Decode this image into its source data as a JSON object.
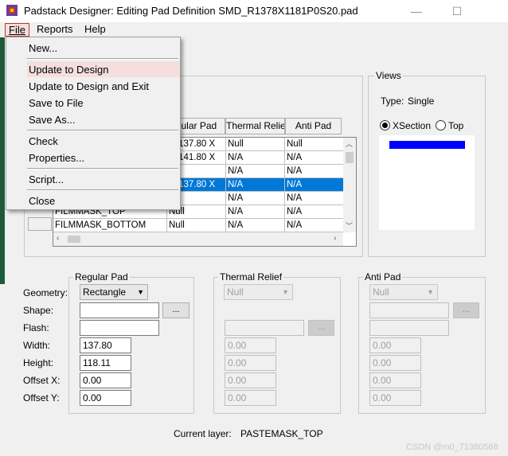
{
  "window": {
    "title": "Padstack Designer: Editing Pad Definition SMD_R1378X1181P0S20.pad",
    "minimize": "—",
    "maximize": "☐"
  },
  "menubar": {
    "items": [
      {
        "label": "File"
      },
      {
        "label": "Reports"
      },
      {
        "label": "Help"
      }
    ]
  },
  "file_menu": {
    "items": [
      {
        "label": "New..."
      },
      {
        "label": "Update to Design"
      },
      {
        "label": "Update to Design and Exit"
      },
      {
        "label": "Save to File"
      },
      {
        "label": "Save As..."
      },
      {
        "label": "Check"
      },
      {
        "label": "Properties..."
      },
      {
        "label": "Script..."
      },
      {
        "label": "Close"
      }
    ],
    "highlighted": "Update to Design"
  },
  "layer_grid": {
    "headers": [
      "gular Pad",
      "Thermal Relief",
      "Anti Pad"
    ],
    "rows": [
      {
        "layer": "",
        "regular": "ct 137.80 X",
        "thermal": "Null",
        "anti": "Null"
      },
      {
        "layer": "",
        "regular": "ct 141.80 X",
        "thermal": "N/A",
        "anti": "N/A"
      },
      {
        "layer": "",
        "regular": "l",
        "thermal": "N/A",
        "anti": "N/A"
      },
      {
        "layer": "",
        "regular": "ct 137.80 X",
        "thermal": "N/A",
        "anti": "N/A",
        "selected": true
      },
      {
        "layer": "",
        "regular": "",
        "thermal": "N/A",
        "anti": "N/A"
      },
      {
        "layer": "FILMMASK_TOP",
        "regular": "Null",
        "thermal": "N/A",
        "anti": "N/A"
      },
      {
        "layer": "FILMMASK_BOTTOM",
        "regular": "Null",
        "thermal": "N/A",
        "anti": "N/A"
      }
    ]
  },
  "views": {
    "group_label": "Views",
    "type_label": "Type:",
    "type_value": "Single",
    "radio_xsection": "XSection",
    "radio_top": "Top",
    "selected": "XSection",
    "preview_color": "#0000ff"
  },
  "regular_pad": {
    "group_label": "Regular Pad",
    "geometry": "Rectangle",
    "shape": "",
    "flash": "",
    "width": "137.80",
    "height": "118.11",
    "offset_x": "0.00",
    "offset_y": "0.00"
  },
  "labels": {
    "geometry": "Geometry:",
    "shape": "Shape:",
    "flash": "Flash:",
    "width": "Width:",
    "height": "Height:",
    "offset_x": "Offset X:",
    "offset_y": "Offset Y:",
    "ellipsis": "..."
  },
  "thermal_relief": {
    "group_label": "Thermal Relief",
    "geometry": "Null",
    "width": "0.00",
    "height": "0.00",
    "offset_x": "0.00",
    "offset_y": "0.00"
  },
  "anti_pad": {
    "group_label": "Anti Pad",
    "geometry": "Null",
    "width": "0.00",
    "height": "0.00",
    "offset_x": "0.00",
    "offset_y": "0.00"
  },
  "status": {
    "current_layer_label": "Current layer:",
    "current_layer_value": "PASTEMASK_TOP"
  },
  "watermark": "CSDN @m0_71380568"
}
